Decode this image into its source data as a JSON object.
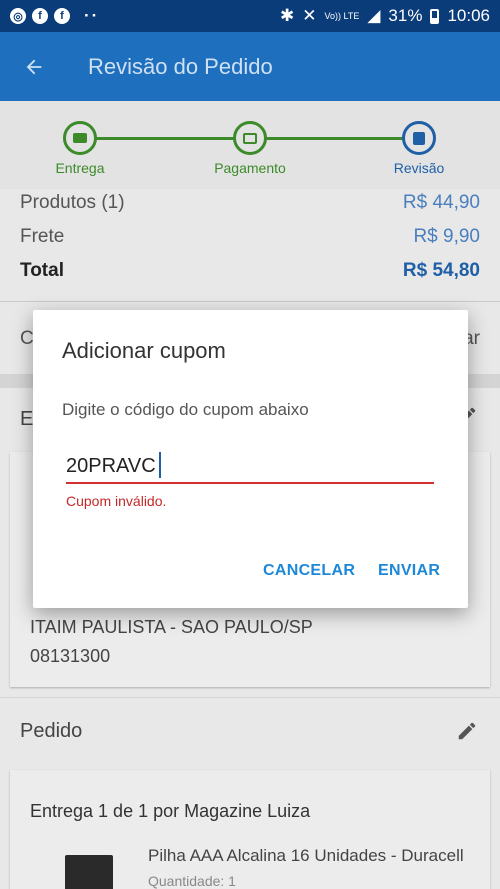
{
  "status_bar": {
    "left_icons": [
      "chrome-icon",
      "facebook-icon",
      "facebook-icon"
    ],
    "more": "··",
    "network": "Vo)) LTE",
    "battery": "31%",
    "time": "10:06"
  },
  "app_bar": {
    "title": "Revisão do Pedido"
  },
  "steps": [
    {
      "label": "Entrega",
      "icon": "truck-icon",
      "color": "#3c8a2a"
    },
    {
      "label": "Pagamento",
      "icon": "card-icon",
      "color": "#3c8a2a"
    },
    {
      "label": "Revisão",
      "icon": "document-icon",
      "color": "#1f5fa6"
    }
  ],
  "summary": {
    "products_label": "Produtos (1)",
    "products_value": "R$ 44,90",
    "shipping_label": "Frete",
    "shipping_value": "R$ 9,90",
    "total_label": "Total",
    "total_value": "R$ 54,80"
  },
  "coupon_row": {
    "left_partial": "C",
    "right_partial": "ar"
  },
  "delivery": {
    "title_partial": "E",
    "address_line1": "ITAIM PAULISTA - SAO PAULO/SP",
    "address_line2": "08131300"
  },
  "order": {
    "title": "Pedido",
    "card_heading": "Entrega 1 de 1 por Magazine Luiza",
    "product_name": "Pilha AAA Alcalina 16 Unidades - Duracell",
    "quantity": "Quantidade: 1"
  },
  "dialog": {
    "title": "Adicionar cupom",
    "message": "Digite o código do cupom abaixo",
    "input_value": "20PRAVC",
    "error": "Cupom inválido.",
    "cancel_label": "CANCELAR",
    "send_label": "ENVIAR"
  },
  "colors": {
    "primary": "#1f6fbf",
    "status_bar": "#0b3c7a",
    "success": "#3c8a2a",
    "accent": "#1e88d8",
    "error": "#c62828"
  }
}
